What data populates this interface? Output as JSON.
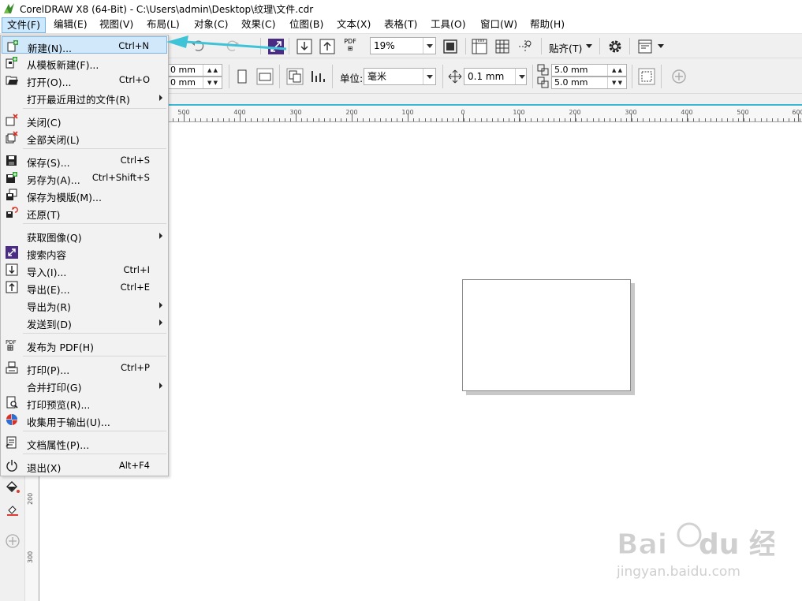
{
  "app": {
    "title": "CorelDRAW X8 (64-Bit) - C:\\Users\\admin\\Desktop\\纹理\\文件.cdr"
  },
  "menubar": [
    {
      "label": "文件(F)",
      "active": true
    },
    {
      "label": "编辑(E)"
    },
    {
      "label": "视图(V)"
    },
    {
      "label": "布局(L)"
    },
    {
      "label": "对象(C)"
    },
    {
      "label": "效果(C)"
    },
    {
      "label": "位图(B)"
    },
    {
      "label": "文本(X)"
    },
    {
      "label": "表格(T)"
    },
    {
      "label": "工具(O)"
    },
    {
      "label": "窗口(W)"
    },
    {
      "label": "帮助(H)"
    }
  ],
  "toolbar1": {
    "zoom": "19%",
    "snap": "贴齐(T)",
    "pdf_icon_text": "PDF"
  },
  "toolbar2": {
    "width": "0 mm",
    "height": "0 mm",
    "units_label": "单位:",
    "units_value": "毫米",
    "nudge": "0.1 mm",
    "dup_x": "5.0 mm",
    "dup_y": "5.0 mm"
  },
  "ruler_h": [
    "500",
    "400",
    "300",
    "200",
    "100",
    "0",
    "100",
    "200",
    "300",
    "400",
    "500",
    "600"
  ],
  "ruler_v": [
    "200",
    "300"
  ],
  "file_menu": [
    {
      "label": "新建(N)...",
      "shortcut": "Ctrl+N",
      "icon": "new-doc-icon",
      "highlight": true
    },
    {
      "label": "从模板新建(F)...",
      "shortcut": "",
      "icon": "new-from-template-icon"
    },
    {
      "label": "打开(O)...",
      "shortcut": "Ctrl+O",
      "icon": "open-folder-icon"
    },
    {
      "label": "打开最近用过的文件(R)",
      "shortcut": "",
      "icon": "",
      "submenu": true
    },
    {
      "sep": true
    },
    {
      "label": "关闭(C)",
      "shortcut": "",
      "icon": "close-doc-icon"
    },
    {
      "label": "全部关闭(L)",
      "shortcut": "",
      "icon": "close-all-icon"
    },
    {
      "sep": true
    },
    {
      "label": "保存(S)...",
      "shortcut": "Ctrl+S",
      "icon": "save-icon"
    },
    {
      "label": "另存为(A)...",
      "shortcut": "Ctrl+Shift+S",
      "icon": "save-as-icon"
    },
    {
      "label": "保存为模版(M)...",
      "shortcut": "",
      "icon": "save-template-icon"
    },
    {
      "label": "还原(T)",
      "shortcut": "",
      "icon": "revert-icon"
    },
    {
      "sep": true
    },
    {
      "label": "获取图像(Q)",
      "shortcut": "",
      "icon": "",
      "submenu": true
    },
    {
      "label": "搜索内容",
      "shortcut": "",
      "icon": "search-content-icon"
    },
    {
      "label": "导入(I)...",
      "shortcut": "Ctrl+I",
      "icon": "import-icon"
    },
    {
      "label": "导出(E)...",
      "shortcut": "Ctrl+E",
      "icon": "export-icon"
    },
    {
      "label": "导出为(R)",
      "shortcut": "",
      "icon": "",
      "submenu": true
    },
    {
      "label": "发送到(D)",
      "shortcut": "",
      "icon": "",
      "submenu": true
    },
    {
      "sep": true
    },
    {
      "label": "发布为 PDF(H)",
      "shortcut": "",
      "icon": "pdf-icon"
    },
    {
      "sep": true
    },
    {
      "label": "打印(P)...",
      "shortcut": "Ctrl+P",
      "icon": "print-icon"
    },
    {
      "label": "合并打印(G)",
      "shortcut": "",
      "icon": "",
      "submenu": true
    },
    {
      "label": "打印预览(R)...",
      "shortcut": "",
      "icon": "print-preview-icon"
    },
    {
      "label": "收集用于输出(U)...",
      "shortcut": "",
      "icon": "collect-output-icon"
    },
    {
      "sep": true
    },
    {
      "label": "文档属性(P)...",
      "shortcut": "",
      "icon": "doc-properties-icon"
    },
    {
      "sep": true
    },
    {
      "label": "退出(X)",
      "shortcut": "Alt+F4",
      "icon": "power-icon"
    }
  ],
  "watermark": {
    "brand": "Bai du 经验",
    "url": "jingyan.baidu.com"
  },
  "colors": {
    "accent": "#3ab8d8",
    "menu_highlight": "#d1e8fb",
    "arrow": "#3fc3d6"
  }
}
